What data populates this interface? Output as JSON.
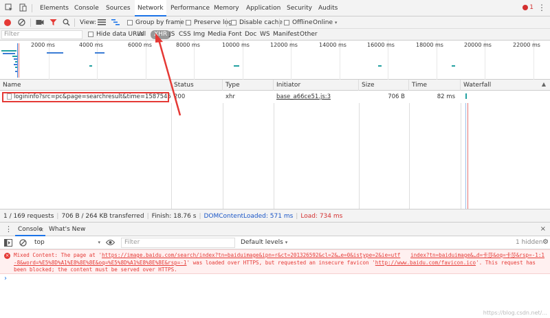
{
  "tabs": [
    {
      "label": "Elements"
    },
    {
      "label": "Console"
    },
    {
      "label": "Sources"
    },
    {
      "label": "Network"
    },
    {
      "label": "Performance"
    },
    {
      "label": "Memory"
    },
    {
      "label": "Application"
    },
    {
      "label": "Security"
    },
    {
      "label": "Audits"
    }
  ],
  "active_tab": "Network",
  "error_count": "1",
  "toolbar": {
    "view_label": "View:",
    "group_by_frame": "Group by frame",
    "preserve_log": "Preserve log",
    "disable_cache": "Disable cache",
    "offline": "Offline",
    "throttling": "Online"
  },
  "filter_bar": {
    "placeholder": "Filter",
    "hide_data_urls": "Hide data URLs",
    "types": [
      "All",
      "XHR",
      "JS",
      "CSS",
      "Img",
      "Media",
      "Font",
      "Doc",
      "WS",
      "Manifest",
      "Other"
    ],
    "active_type": "XHR"
  },
  "overview": {
    "ticks": [
      "2000 ms",
      "4000 ms",
      "6000 ms",
      "8000 ms",
      "10000 ms",
      "12000 ms",
      "14000 ms",
      "16000 ms",
      "18000 ms",
      "20000 ms",
      "22000 ms"
    ]
  },
  "table": {
    "columns": [
      "Name",
      "Status",
      "Type",
      "Initiator",
      "Size",
      "Time",
      "Waterfall"
    ],
    "rows": [
      {
        "name": "logininfo?src=pc&page=searchresult&time=1587545117074",
        "status": "200",
        "type": "xhr",
        "initiator": "base_a66ce51.js:3",
        "size": "706 B",
        "time": "82 ms"
      }
    ]
  },
  "summary": {
    "requests": "1 / 169 requests",
    "transferred": "706 B / 264 KB transferred",
    "finish": "Finish: 18.76 s",
    "dom_content_loaded": "DOMContentLoaded: 571 ms",
    "load": "Load: 734 ms"
  },
  "drawer": {
    "tabs": [
      "Console",
      "What's New"
    ],
    "context": "top",
    "filter_placeholder": "Filter",
    "levels": "Default levels",
    "hidden": "1 hidden"
  },
  "console_error": {
    "line1_pre": "Mixed Content: The page at '",
    "url1": "https://image.baidu.com/search/index?tn=baiduimage&ipn=r&ct=201326592&cl=2&…e=0&istype=2&ie=utf",
    "url1_cont": "-8&word=%E5%8D%A1%E8%8E%8E&oq=%E5%8D%A1%E8%8E%8E&rsp=-1",
    "line2_mid": "' was loaded over HTTPS, but requested an insecure favicon '",
    "url2": "http://www.baidu.com/favicon.ico",
    "line2_post": "'. This request has",
    "line3": "been blocked; the content must be served over HTTPS.",
    "source": "index?tn=baiduimage&…d=卡莎&oq=卡莎&rsp=-1:1"
  },
  "prompt_symbol": "›",
  "watermark": "https://blog.csdn.net/..."
}
